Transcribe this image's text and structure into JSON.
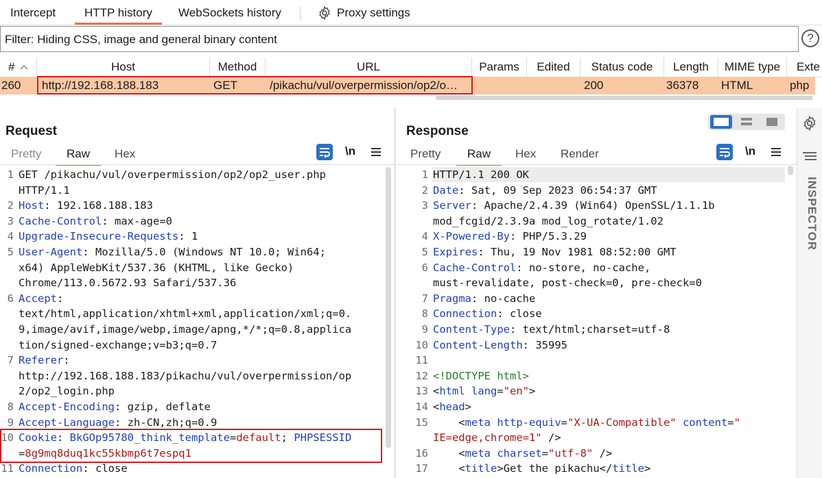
{
  "tabs": {
    "intercept": "Intercept",
    "http_history": "HTTP history",
    "websockets_history": "WebSockets history",
    "proxy_settings": "Proxy settings"
  },
  "filter": {
    "text": "Filter: Hiding CSS, image and general binary content",
    "help": "?"
  },
  "table": {
    "headers": {
      "num": "#",
      "host": "Host",
      "method": "Method",
      "url": "URL",
      "params": "Params",
      "edited": "Edited",
      "status": "Status code",
      "length": "Length",
      "mime": "MIME type",
      "ext": "Exte"
    },
    "row": {
      "num": "260",
      "host": "http://192.168.188.183",
      "method": "GET",
      "url": "/pikachu/vul/overpermission/op2/o…",
      "status": "200",
      "length": "36378",
      "mime": "HTML",
      "ext": "php"
    }
  },
  "request": {
    "title": "Request",
    "tabs": {
      "pretty": "Pretty",
      "raw": "Raw",
      "hex": "Hex"
    },
    "newline_toggle": "\\n",
    "lines": {
      "l1a": "GET /pikachu/vul/overpermission/op2/op2_user.php",
      "l1b": "HTTP/1.1",
      "h2": "Host",
      "v2": ": 192.168.188.183",
      "h3": "Cache-Control",
      "v3": ": max-age=0",
      "h4": "Upgrade-Insecure-Requests",
      "v4": ": 1",
      "h5": "User-Agent",
      "v5": ": Mozilla/5.0 (Windows NT 10.0; Win64;",
      "v5b": "x64) AppleWebKit/537.36 (KHTML, like Gecko)",
      "v5c": "Chrome/113.0.5672.93 Safari/537.36",
      "h6": "Accept",
      "v6": ":",
      "v6b": "text/html,application/xhtml+xml,application/xml;q=0.",
      "v6c": "9,image/avif,image/webp,image/apng,*/*;q=0.8,applica",
      "v6d": "tion/signed-exchange;v=b3;q=0.7",
      "h7": "Referer",
      "v7": ":",
      "v7b": "http://192.168.188.183/pikachu/vul/overpermission/op",
      "v7c": "2/op2_login.php",
      "h8": "Accept-Encoding",
      "v8": ": gzip, deflate",
      "h9": "Accept-Language",
      "v9": ": zh-CN,zh;q=0.9",
      "h10": "Cookie",
      "v10a": ": ",
      "ck1": "BkGOp95780_think_template",
      "v10b": "=",
      "cv1": "default",
      "v10c": "; ",
      "ck2": "PHPSESSID",
      "v10d": "=",
      "cv2": "8g9mq8duq1kc55kbmp6t7espq1",
      "h11": "Connection",
      "v11": ": close"
    }
  },
  "response": {
    "title": "Response",
    "tabs": {
      "pretty": "Pretty",
      "raw": "Raw",
      "hex": "Hex",
      "render": "Render"
    },
    "newline_toggle": "\\n",
    "lines": {
      "l1": "HTTP/1.1 200 OK",
      "h2": "Date",
      "v2": ": Sat, 09 Sep 2023 06:54:37 GMT",
      "h3": "Server",
      "v3": ": Apache/2.4.39 (Win64) OpenSSL/1.1.1b",
      "v3b": "mod_fcgid/2.3.9a mod_log_rotate/1.02",
      "h4": "X-Powered-By",
      "v4": ": PHP/5.3.29",
      "h5": "Expires",
      "v5": ": Thu, 19 Nov 1981 08:52:00 GMT",
      "h6": "Cache-Control",
      "v6": ": no-store, no-cache,",
      "v6b": "must-revalidate, post-check=0, pre-check=0",
      "h7": "Pragma",
      "v7": ": no-cache",
      "h8": "Connection",
      "v8": ": close",
      "h9": "Content-Type",
      "v9": ": text/html;charset=utf-8",
      "h10": "Content-Length",
      "v10": ": 35995",
      "l12": "<!DOCTYPE html>",
      "l13a": "<",
      "l13tag": "html",
      "l13attr": " lang",
      "l13eq": "=",
      "l13val": "\"en\"",
      "l13end": ">",
      "l14a": "<",
      "l14tag": "head",
      "l14end": ">",
      "l15a": "    <",
      "l15tag": "meta",
      "l15attr1": " http-equiv",
      "l15eq1": "=",
      "l15val1": "\"X-UA-Compatible\"",
      "l15attr2": " content",
      "l15eq2": "=",
      "l15val2a": "\"",
      "l15val2b": "IE=edge,chrome=1\"",
      "l15end": " />",
      "l16a": "    <",
      "l16tag": "meta",
      "l16attr": " charset",
      "l16eq": "=",
      "l16val": "\"utf-8\"",
      "l16end": " />",
      "l17a": "    <",
      "l17tag": "title",
      "l17gt": ">",
      "l17text": "Get the pikachu",
      "l17close": "</",
      "l17ctag": "title",
      "l17cend": ">"
    }
  },
  "inspector": {
    "label": "INSPECTOR"
  },
  "icons": {
    "gear": "gear-icon",
    "sort": "sort-asc-icon",
    "wrap": "word-wrap-icon",
    "menu": "hamburger-icon",
    "list": "list-icon"
  }
}
